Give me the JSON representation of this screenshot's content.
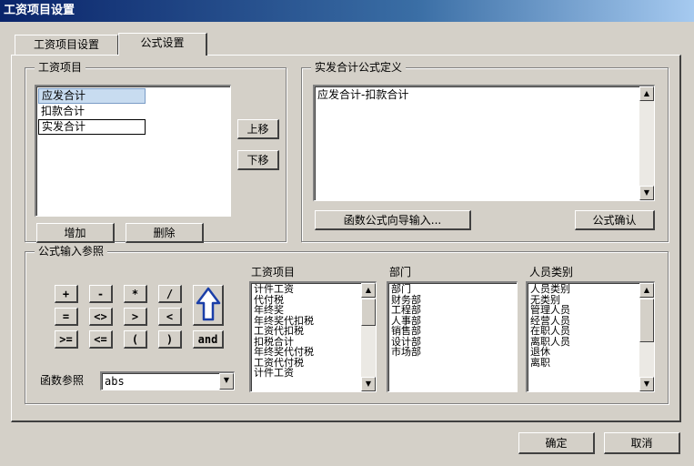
{
  "window": {
    "title": "工资项目设置"
  },
  "tabs": [
    {
      "label": "工资项目设置"
    },
    {
      "label": "公式设置"
    }
  ],
  "salary_items_group": {
    "legend": "工资项目",
    "items": [
      "应发合计",
      "扣款合计",
      "实发合计"
    ],
    "move_up_label": "上移",
    "move_down_label": "下移",
    "add_label": "增加",
    "delete_label": "删除"
  },
  "formula_group": {
    "legend": "实发合计公式定义",
    "formula_text": "应发合计-扣款合计",
    "wizard_label": "函数公式向导输入...",
    "confirm_label": "公式确认"
  },
  "reference_group": {
    "legend": "公式输入参照",
    "operators": [
      "+",
      "-",
      "*",
      "/",
      "=",
      "<>",
      ">",
      "<",
      ">=",
      "<=",
      "(",
      ")",
      "and"
    ],
    "function_label": "函数参照",
    "function_value": "abs",
    "lists": {
      "salary_items": {
        "label": "工资项目",
        "items": [
          "计件工资",
          "代付税",
          "年终奖",
          "年终奖代扣税",
          "工资代扣税",
          "扣税合计",
          "年终奖代付税",
          "工资代付税",
          "计件工资"
        ]
      },
      "departments": {
        "label": "部门",
        "items": [
          "部门",
          "财务部",
          "工程部",
          "人事部",
          "销售部",
          "设计部",
          "市场部"
        ]
      },
      "person_types": {
        "label": "人员类别",
        "items": [
          "人员类别",
          "无类别",
          "管理人员",
          "经营人员",
          "在职人员",
          "离职人员",
          "退休",
          "离职"
        ]
      }
    }
  },
  "footer": {
    "ok_label": "确定",
    "cancel_label": "取消"
  }
}
